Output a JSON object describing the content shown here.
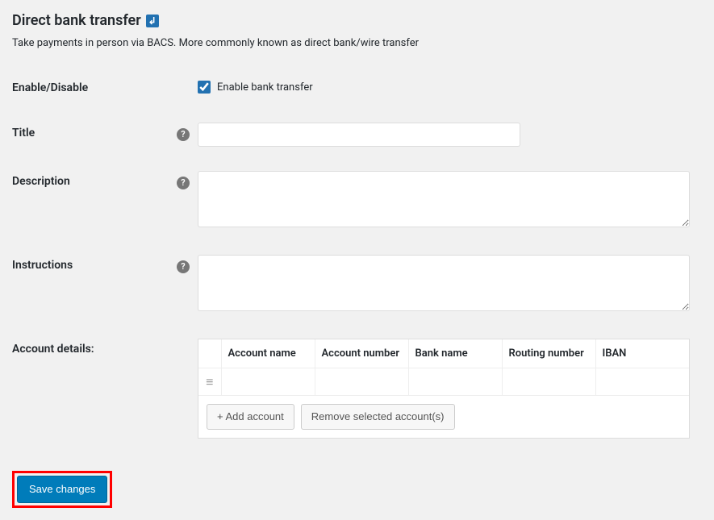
{
  "header": {
    "title": "Direct bank transfer",
    "back_symbol": "↲",
    "description": "Take payments in person via BACS. More commonly known as direct bank/wire transfer"
  },
  "fields": {
    "enable": {
      "label": "Enable/Disable",
      "checkbox_label": "Enable bank transfer",
      "checked": true
    },
    "title": {
      "label": "Title",
      "value": ""
    },
    "description": {
      "label": "Description",
      "value": ""
    },
    "instructions": {
      "label": "Instructions",
      "value": ""
    },
    "accounts": {
      "label": "Account details:",
      "columns": [
        "Account name",
        "Account number",
        "Bank name",
        "Routing number",
        "IBAN"
      ],
      "rows": [
        {
          "account_name": "",
          "account_number": "",
          "bank_name": "",
          "routing_number": "",
          "iban": ""
        }
      ],
      "add_label": "+ Add account",
      "remove_label": "Remove selected account(s)"
    }
  },
  "actions": {
    "save": "Save changes"
  },
  "help_glyph": "?",
  "sort_glyph": "≡"
}
